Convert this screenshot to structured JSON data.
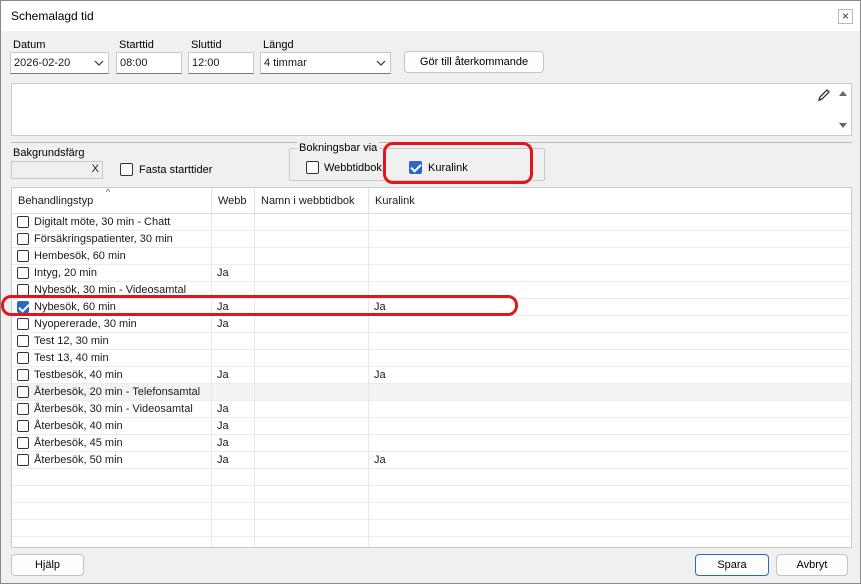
{
  "window": {
    "title": "Schemalagd tid"
  },
  "form": {
    "datum_label": "Datum",
    "datum_value": "2026-02-20",
    "starttid_label": "Starttid",
    "starttid_value": "08:00",
    "sluttid_label": "Sluttid",
    "sluttid_value": "12:00",
    "langd_label": "Längd",
    "langd_value": "4 timmar",
    "recurring_button": "Gör till återkommande"
  },
  "background": {
    "label": "Bakgrundsfärg",
    "clear": "X"
  },
  "fixed_start": {
    "label": "Fasta starttider",
    "checked": false
  },
  "booking": {
    "legend": "Bokningsbar via",
    "webbtidbok": {
      "label": "Webbtidbok",
      "checked": false
    },
    "kuralink": {
      "label": "Kuralink",
      "checked": true
    }
  },
  "table": {
    "columns": [
      "Behandlingstyp",
      "Webb",
      "Namn i webbtidbok",
      "Kuralink"
    ],
    "rows": [
      {
        "name": "Digitalt möte, 30 min - Chatt",
        "webb": "",
        "namn": "",
        "kuralink": "",
        "checked": false
      },
      {
        "name": "Försäkringspatienter, 30 min",
        "webb": "",
        "namn": "",
        "kuralink": "",
        "checked": false
      },
      {
        "name": "Hembesök, 60 min",
        "webb": "",
        "namn": "",
        "kuralink": "",
        "checked": false
      },
      {
        "name": "Intyg, 20 min",
        "webb": "Ja",
        "namn": "",
        "kuralink": "",
        "checked": false
      },
      {
        "name": "Nybesök, 30 min - Videosamtal",
        "webb": "",
        "namn": "",
        "kuralink": "",
        "checked": false
      },
      {
        "name": "Nybesök, 60 min",
        "webb": "Ja",
        "namn": "",
        "kuralink": "Ja",
        "checked": true
      },
      {
        "name": "Nyopererade, 30 min",
        "webb": "Ja",
        "namn": "",
        "kuralink": "",
        "checked": false
      },
      {
        "name": "Test 12, 30 min",
        "webb": "",
        "namn": "",
        "kuralink": "",
        "checked": false
      },
      {
        "name": "Test 13, 40 min",
        "webb": "",
        "namn": "",
        "kuralink": "",
        "checked": false
      },
      {
        "name": "Testbesök, 40 min",
        "webb": "Ja",
        "namn": "",
        "kuralink": "Ja",
        "checked": false
      },
      {
        "name": "Återbesök, 20 min - Telefonsamtal",
        "webb": "",
        "namn": "",
        "kuralink": "",
        "checked": false
      },
      {
        "name": "Återbesök, 30 min - Videosamtal",
        "webb": "Ja",
        "namn": "",
        "kuralink": "",
        "checked": false
      },
      {
        "name": "Återbesök, 40 min",
        "webb": "Ja",
        "namn": "",
        "kuralink": "",
        "checked": false
      },
      {
        "name": "Återbesök, 45 min",
        "webb": "Ja",
        "namn": "",
        "kuralink": "",
        "checked": false
      },
      {
        "name": "Återbesök, 50 min",
        "webb": "Ja",
        "namn": "",
        "kuralink": "Ja",
        "checked": false
      }
    ]
  },
  "footer": {
    "help": "Hjälp",
    "save": "Spara",
    "cancel": "Avbryt"
  },
  "colors": {
    "accent": "#2a69c4",
    "highlight": "#e0161c"
  }
}
